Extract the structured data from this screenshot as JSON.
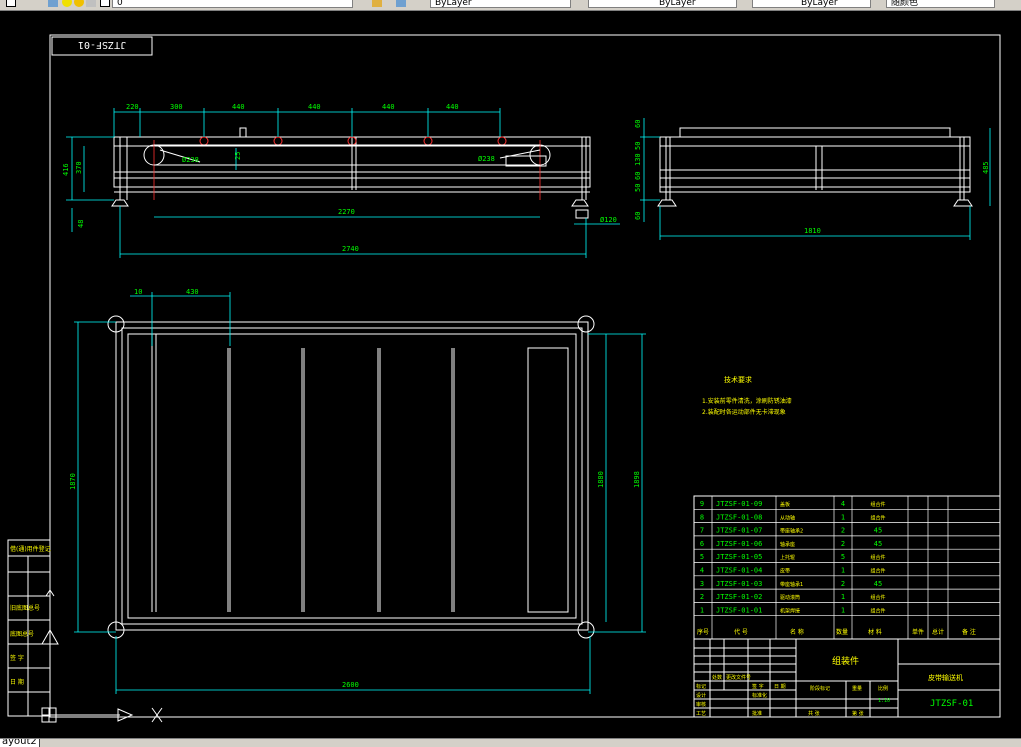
{
  "toolbar": {
    "layer_value": "0",
    "color_value": "ByLayer",
    "linetype_value": "ByLayer",
    "lineweight_value": "ByLayer",
    "plotstyle_value": "随颜色"
  },
  "layout_tab": "ayout2",
  "drawing": {
    "code_box": "JTZSF-01",
    "front_view": {
      "top_dims": [
        "220",
        "300",
        "440",
        "440",
        "440",
        "440"
      ],
      "height_dims": [
        "416",
        "370",
        "48"
      ],
      "center_dim": "25",
      "roller_diameter_left": "Ø238",
      "roller_diameter_right": "Ø238",
      "inner_length": "2270",
      "total_length": "2740",
      "foot_dim": "Ø120"
    },
    "side_view": {
      "vert_dims": [
        "60",
        "50",
        "130",
        "60",
        "50",
        "60"
      ],
      "height_dim": "485",
      "width_dim": "1810"
    },
    "plan_view": {
      "top_dims": [
        "10",
        "430"
      ],
      "left_dim": "1870",
      "right_dims": [
        "1880",
        "1898"
      ],
      "bottom_dim": "2600"
    },
    "tech_requirements": {
      "title": "技术要求",
      "lines": [
        "1.安装前零件清洗，涂刷防锈油漆",
        "2.装配时各运动部件无卡滞现象"
      ]
    },
    "left_block": [
      "借(通)用件登记",
      "",
      "旧底图总号",
      "",
      "底图总号",
      "签 字",
      "日 期"
    ],
    "bom": {
      "rows": [
        {
          "no": "9",
          "code": "JTZSF-01-09",
          "name": "盖板",
          "qty": "4",
          "material": "组合件"
        },
        {
          "no": "8",
          "code": "JTZSF-01-08",
          "name": "从动轴",
          "qty": "1",
          "material": "组合件"
        },
        {
          "no": "7",
          "code": "JTZSF-01-07",
          "name": "带座轴承2",
          "qty": "2",
          "material": "45"
        },
        {
          "no": "6",
          "code": "JTZSF-01-06",
          "name": "轴承座",
          "qty": "2",
          "material": "45"
        },
        {
          "no": "5",
          "code": "JTZSF-01-05",
          "name": "上托辊",
          "qty": "5",
          "material": "组合件"
        },
        {
          "no": "4",
          "code": "JTZSF-01-04",
          "name": "皮带",
          "qty": "1",
          "material": "组合件"
        },
        {
          "no": "3",
          "code": "JTZSF-01-03",
          "name": "带座轴承1",
          "qty": "2",
          "material": "45"
        },
        {
          "no": "2",
          "code": "JTZSF-01-02",
          "name": "驱动滚筒",
          "qty": "1",
          "material": "组合件"
        },
        {
          "no": "1",
          "code": "JTZSF-01-01",
          "name": "机架焊接",
          "qty": "1",
          "material": "组合件"
        }
      ],
      "header": [
        "序号",
        "代 号",
        "名 称",
        "数量",
        "材 料",
        "单件",
        "总计",
        "备 注"
      ]
    },
    "title_block": {
      "part_type": "组装件",
      "product_name": "皮带输送机",
      "drawing_no": "JTZSF-01",
      "labels": [
        "标记",
        "处数",
        "更改文件号",
        "签 字",
        "日 期",
        "设计",
        "标准化",
        "审核",
        "工艺",
        "阶段标记",
        "重量",
        "比例",
        "批准",
        "共 张",
        "第 张"
      ],
      "scale": "1:10"
    }
  }
}
